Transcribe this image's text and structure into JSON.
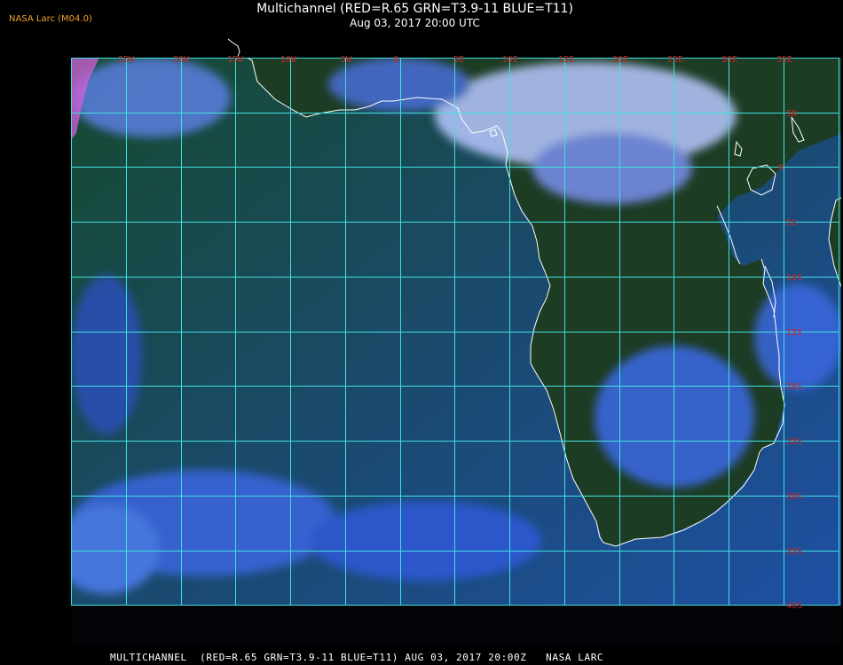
{
  "header": {
    "app_label": "NASA Larc (M04.0)",
    "title": "Multichannel (RED=R.65 GRN=T3.9-11 BLUE=T11)",
    "subtitle": "Aug 03, 2017 20:00 UTC"
  },
  "footer": {
    "text": "MULTICHANNEL  (RED=R.65 GRN=T3.9-11 BLUE=T11) AUG 03, 2017 20:00Z   NASA LARC"
  },
  "map": {
    "longitude_labels": [
      "25W",
      "20W",
      "15W",
      "10W",
      "5W",
      "0",
      "5E",
      "10E",
      "15E",
      "20E",
      "25E",
      "30E",
      "35E"
    ],
    "latitude_labels": [
      "5N",
      "0",
      "5S",
      "10S",
      "15S",
      "20S",
      "25S",
      "30S",
      "35S",
      "40S"
    ],
    "colors": {
      "grid": "#40e0e0",
      "tick_label": "#c82828",
      "coastline": "#ffffff",
      "ocean": "#1a4a7a",
      "land": "#1d3a22",
      "cloud": "#9ab8ff"
    }
  }
}
